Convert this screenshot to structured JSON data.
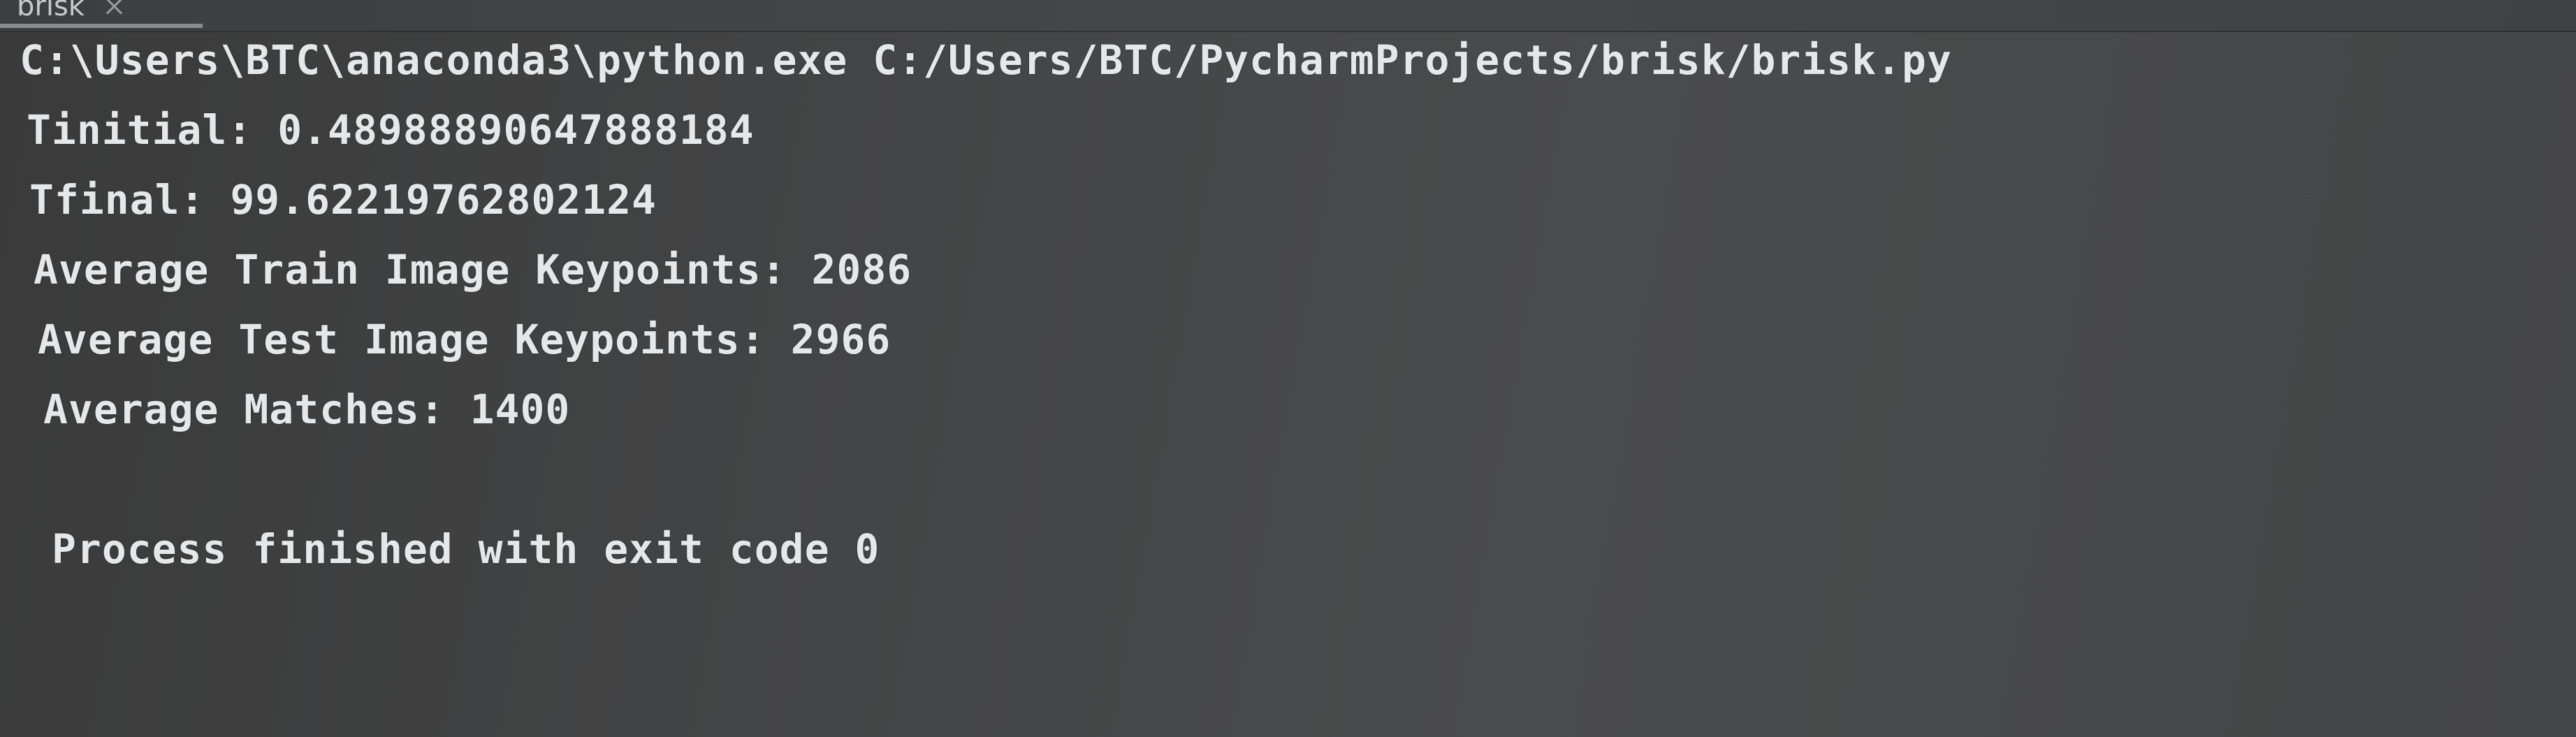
{
  "tab": {
    "label": "brisk",
    "close_icon": "close-icon"
  },
  "console": {
    "lines": [
      "C:\\Users\\BTC\\anaconda3\\python.exe C:/Users/BTC/PycharmProjects/brisk/brisk.py",
      "Tinitial: 0.48988890647888184",
      "Tfinal: 99.62219762802124",
      "Average Train Image Keypoints: 2086",
      "Average Test Image Keypoints: 2966",
      "Average Matches: 1400",
      "Process finished with exit code 0"
    ]
  },
  "colors": {
    "background": "#454647",
    "text": "#e6e7e8",
    "tab_text": "#c7c9cc"
  }
}
